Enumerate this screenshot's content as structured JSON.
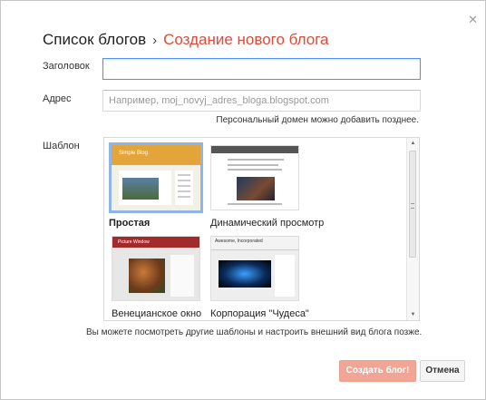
{
  "dialog": {
    "close_icon": "close-icon",
    "breadcrumb": {
      "root": "Список блогов",
      "separator": "›",
      "current": "Создание нового блога"
    },
    "fields": {
      "title_label": "Заголовок",
      "title_value": "",
      "address_label": "Адрес",
      "address_placeholder": "Например, moj_novyj_adres_bloga.blogspot.com",
      "address_hint": "Персональный домен можно добавить позднее."
    },
    "templates_label": "Шаблон",
    "templates": [
      {
        "name": "Простая",
        "thumb_title": "Simple Blog",
        "selected": true
      },
      {
        "name": "Динамический просмотр",
        "selected": false
      },
      {
        "name": "Венецианское окно",
        "thumb_title": "Picture Window",
        "selected": false
      },
      {
        "name": "Корпорация \"Чудеса\"",
        "thumb_title": "Awesome, Incorporated",
        "selected": false
      }
    ],
    "footer_note": "Вы можете посмотреть другие шаблоны и настроить внешний вид блога позже.",
    "buttons": {
      "create": "Создать блог!",
      "cancel": "Отмена"
    },
    "colors": {
      "accent": "#dd4b39",
      "focus": "#4d90fe",
      "create_button": "#f0a595"
    }
  }
}
